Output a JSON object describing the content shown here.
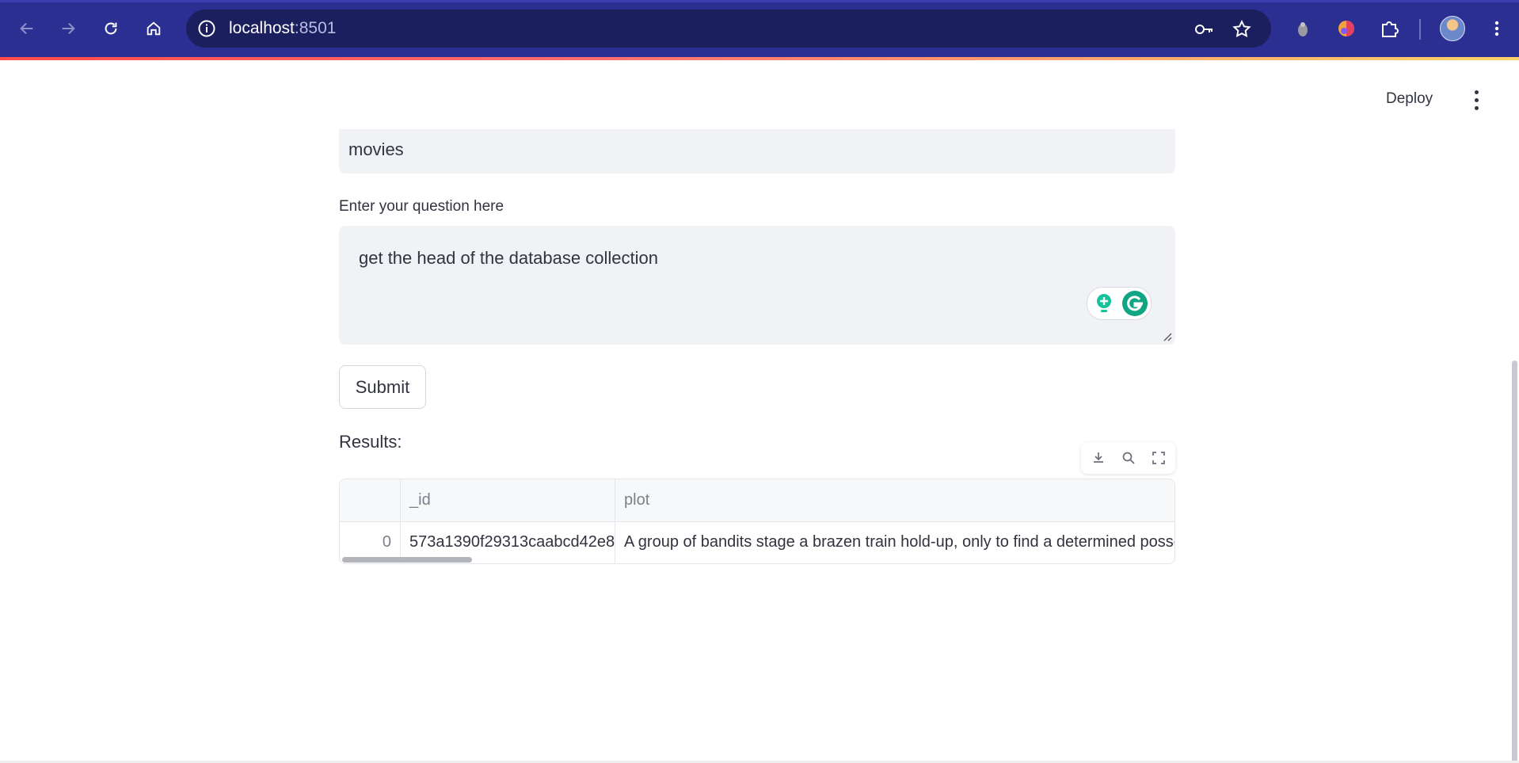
{
  "browser": {
    "url_host": "localhost",
    "url_port": ":8501",
    "icons": [
      "back-arrow-icon",
      "forward-arrow-icon",
      "reload-icon",
      "home-icon",
      "site-info-icon",
      "key-icon",
      "star-icon",
      "extension-grey-icon",
      "extension-color-icon",
      "puzzle-icon",
      "profile-avatar",
      "menu-icon"
    ]
  },
  "app": {
    "deploy_label": "Deploy",
    "collection_value": "movies",
    "question_label": "Enter your question here",
    "question_value": "get the head of the database collection",
    "submit_label": "Submit",
    "results_label": "Results:"
  },
  "table": {
    "columns": [
      "",
      "_id",
      "plot"
    ],
    "rows": [
      {
        "index": "0",
        "_id": "573a1390f29313caabcd42e8",
        "plot": "A group of bandits stage a brazen train hold-up, only to find a determined posse"
      }
    ]
  },
  "colors": {
    "browser_bar": "#2b2f92",
    "omnibox": "#1c1f5e",
    "input_bg": "#f0f2f6",
    "text": "#31333f",
    "grammarly": "#11a683"
  }
}
